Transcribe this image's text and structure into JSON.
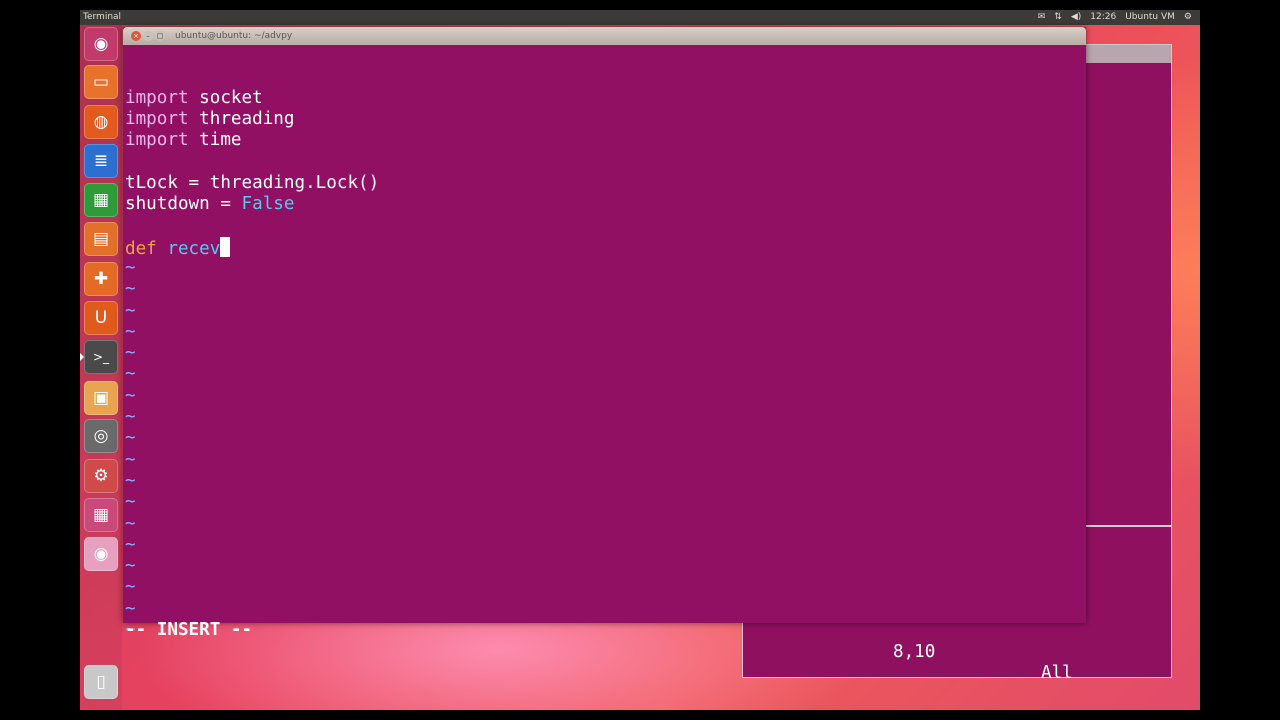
{
  "top_panel": {
    "app_name": "Terminal",
    "indicators": [
      "✉",
      "⇅",
      "◀)",
      "12:26",
      "Ubuntu VM",
      "⚙"
    ]
  },
  "launcher": {
    "items": [
      {
        "name": "dash-icon",
        "glyph": "◉",
        "color": "#c23a6a"
      },
      {
        "name": "files-icon",
        "glyph": "▭",
        "color": "#e8722c"
      },
      {
        "name": "firefox-icon",
        "glyph": "◍",
        "color": "#e25a1c"
      },
      {
        "name": "writer-icon",
        "glyph": "≣",
        "color": "#2d6fd0"
      },
      {
        "name": "calc-icon",
        "glyph": "▦",
        "color": "#2f9a3a"
      },
      {
        "name": "impress-icon",
        "glyph": "▤",
        "color": "#e0702a"
      },
      {
        "name": "software-center-icon",
        "glyph": "✚",
        "color": "#e46a26"
      },
      {
        "name": "ubuntu-one-icon",
        "glyph": "U",
        "color": "#e05a1c"
      },
      {
        "name": "terminal-icon",
        "glyph": ">_",
        "color": "#4a4a4a"
      },
      {
        "name": "bag-icon",
        "glyph": "▣",
        "color": "#e8a450"
      },
      {
        "name": "disk-icon",
        "glyph": "◎",
        "color": "#6a6a6a"
      },
      {
        "name": "settings-icon",
        "glyph": "⚙",
        "color": "#d04a4a"
      },
      {
        "name": "workspaces-icon",
        "glyph": "▦",
        "color": "#c84a7a"
      },
      {
        "name": "dvd-icon",
        "glyph": "◉",
        "color": "#e8a0c0"
      },
      {
        "name": "trash-icon",
        "glyph": "▯",
        "color": "#c8c8c8"
      }
    ]
  },
  "terminal": {
    "title": "ubuntu@ubuntu: ~/advpy",
    "buttons": {
      "close": "×",
      "minimize": "–",
      "maximize": "□"
    },
    "lines": [
      {
        "kw": "import",
        "rest": " socket"
      },
      {
        "kw": "import",
        "rest": " threading"
      },
      {
        "kw": "import",
        "rest": " time"
      },
      {
        "text": ""
      },
      {
        "text": "tLock = threading.Lock()"
      },
      {
        "pre": "shutdown = ",
        "const": "False"
      },
      {
        "text": ""
      },
      {
        "def": "def",
        "sp": " ",
        "fn": "recev"
      }
    ],
    "tilde": "~",
    "tilde_count": 18,
    "status": {
      "mode": "-- INSERT --",
      "position": "8,10",
      "scroll": "All"
    }
  }
}
